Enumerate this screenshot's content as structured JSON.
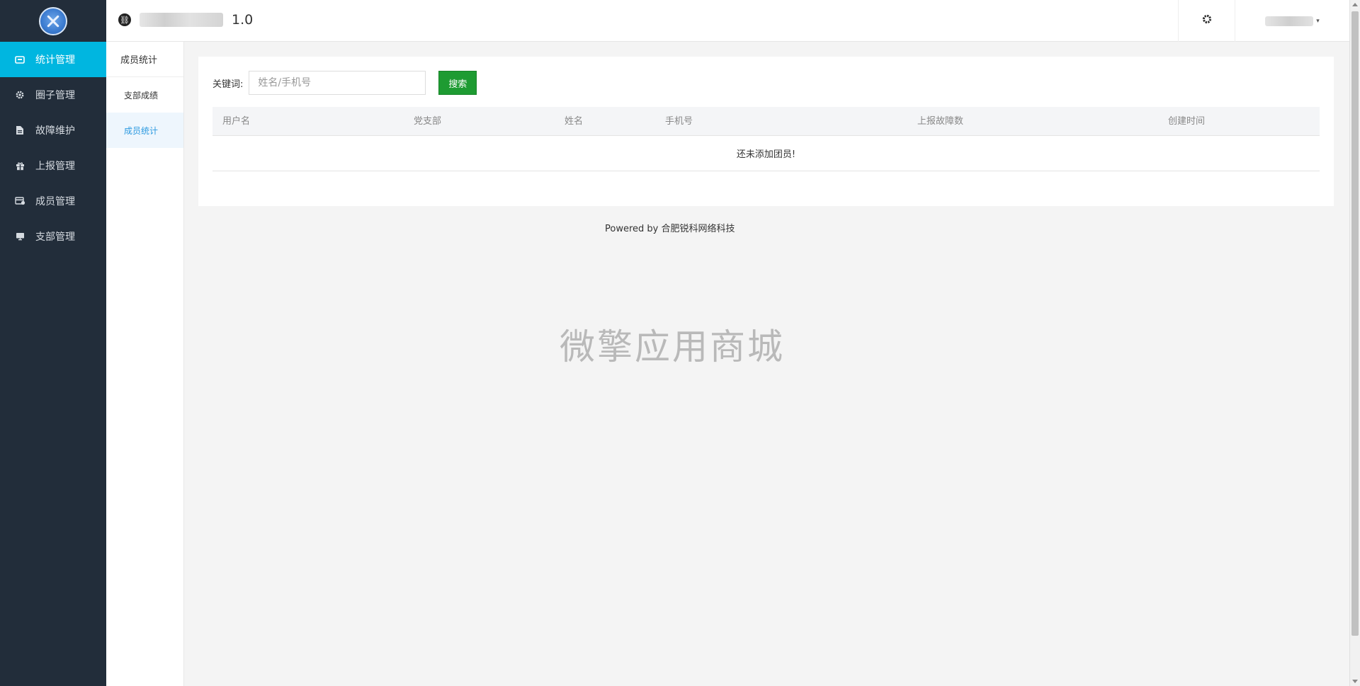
{
  "sidebar": {
    "items": [
      {
        "label": "统计管理",
        "icon": "chart-icon",
        "active": true
      },
      {
        "label": "圈子管理",
        "icon": "gear-icon",
        "active": false
      },
      {
        "label": "故障维护",
        "icon": "file-icon",
        "active": false
      },
      {
        "label": "上报管理",
        "icon": "gift-icon",
        "active": false
      },
      {
        "label": "成员管理",
        "icon": "member-card-icon",
        "active": false
      },
      {
        "label": "支部管理",
        "icon": "monitor-icon",
        "active": false
      }
    ]
  },
  "submenu": {
    "title": "成员统计",
    "items": [
      {
        "label": "支部成绩",
        "active": false
      },
      {
        "label": "成员统计",
        "active": true
      }
    ]
  },
  "header": {
    "version": "1.0"
  },
  "search": {
    "label": "关键词:",
    "placeholder": "姓名/手机号",
    "value": "",
    "button": "搜索"
  },
  "table": {
    "columns": [
      "用户名",
      "党支部",
      "姓名",
      "手机号",
      "上报故障数",
      "创建时间"
    ],
    "rows": [],
    "empty_text": "还未添加团员!"
  },
  "footer": {
    "text": "Powered by 合肥锐科网络科技"
  },
  "watermark": "微擎应用商城",
  "colors": {
    "sidebar_bg": "#222d3a",
    "active_blue": "#00b6e0",
    "search_button": "#1e9b32",
    "sub_active": "#2d9ae0"
  }
}
